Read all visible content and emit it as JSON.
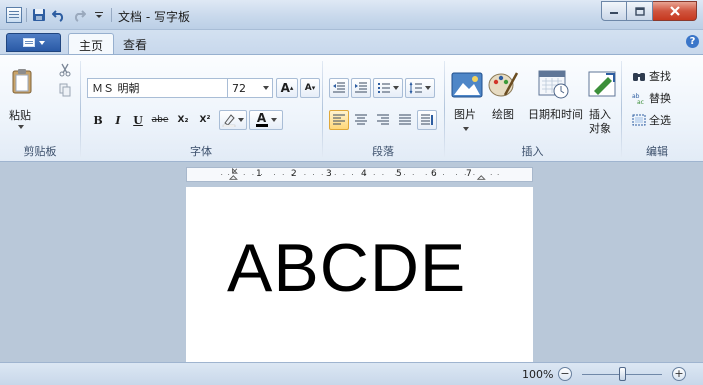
{
  "window": {
    "title": "文档 - 写字板"
  },
  "ribbon_tabs": {
    "home": "主页",
    "view": "查看"
  },
  "clipboard": {
    "paste_label": "粘贴",
    "group_label": "剪贴板"
  },
  "font": {
    "name": "ＭＳ 明朝",
    "size": "72",
    "grow_label": "A",
    "shrink_label": "A",
    "bold_label": "B",
    "italic_label": "I",
    "underline_label": "U",
    "strike_label": "abe",
    "subscript_label": "X₂",
    "superscript_label": "X²",
    "color_label": "A",
    "group_label": "字体"
  },
  "paragraph": {
    "group_label": "段落"
  },
  "insert": {
    "picture_label": "图片",
    "paint_label": "绘图",
    "datetime_label": "日期和时间",
    "object_label_1": "插入",
    "object_label_2": "对象",
    "group_label": "插入"
  },
  "editing": {
    "find_label": "查找",
    "replace_label": "替换",
    "select_all_label": "全选",
    "group_label": "编辑"
  },
  "ruler_numbers": [
    "1",
    "2",
    "3",
    "4",
    "5",
    "6",
    "7"
  ],
  "document": {
    "text": "ABCDE"
  },
  "status": {
    "zoom": "100%",
    "zoom_minus": "−",
    "zoom_plus": "+"
  },
  "colors": {
    "accent": "#2a5aa6",
    "close_button": "#c7381f",
    "active_alignment": "#ffd779"
  }
}
